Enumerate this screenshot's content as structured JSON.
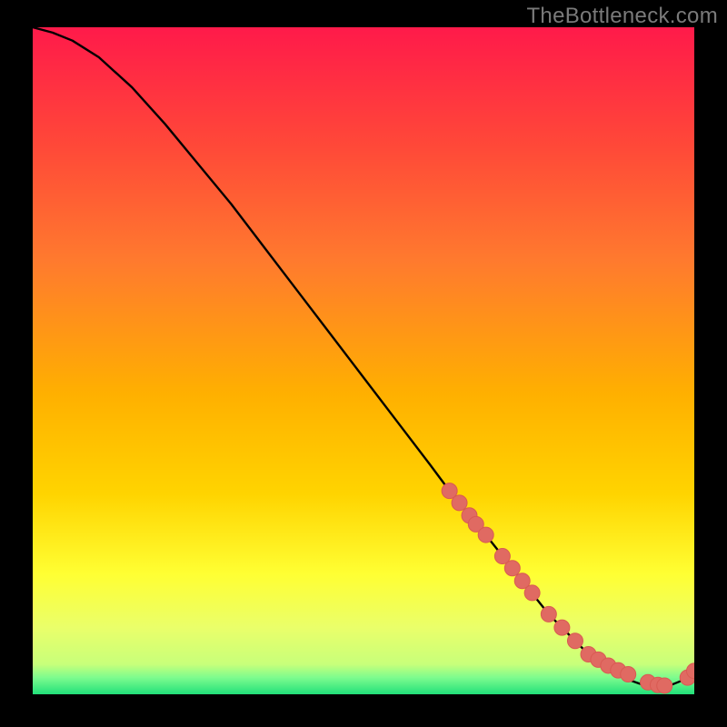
{
  "watermark": "TheBottleneck.com",
  "colors": {
    "bg": "#000000",
    "gradient_top": "#ff1a4a",
    "gradient_mid1": "#ff7a2e",
    "gradient_mid2": "#ffd400",
    "gradient_mid3": "#ffff33",
    "gradient_low": "#eaff6a",
    "gradient_green": "#22e07a",
    "curve": "#000000",
    "marker_fill": "#e06a62",
    "marker_stroke": "#d95a52"
  },
  "chart_data": {
    "type": "line",
    "title": "",
    "xlabel": "",
    "ylabel": "",
    "xlim": [
      0,
      100
    ],
    "ylim": [
      0,
      100
    ],
    "grid": false,
    "series": [
      {
        "name": "bottleneck-curve",
        "x": [
          0,
          3,
          6,
          10,
          15,
          20,
          25,
          30,
          35,
          40,
          45,
          50,
          55,
          60,
          63,
          65,
          68,
          70,
          72,
          74,
          76,
          78,
          80,
          82,
          84,
          86,
          88,
          90,
          92,
          94,
          96,
          98,
          100
        ],
        "y": [
          100,
          99.2,
          98,
          95.5,
          91,
          85.5,
          79.5,
          73.5,
          67,
          60.5,
          54,
          47.5,
          41,
          34.5,
          30.5,
          28,
          24.5,
          22,
          19.5,
          17,
          14.5,
          12,
          10,
          8,
          6,
          4.5,
          3.2,
          2.2,
          1.5,
          1.1,
          1.2,
          2,
          3.5
        ]
      }
    ],
    "markers": {
      "name": "highlighted-points",
      "x": [
        63,
        64.5,
        66,
        67,
        68.5,
        71,
        72.5,
        74,
        75.5,
        78,
        80,
        82,
        84,
        85.5,
        87,
        88.5,
        90,
        93,
        94.5,
        95.5,
        99,
        100
      ],
      "y": [
        30.5,
        28.7,
        26.8,
        25.5,
        23.9,
        20.7,
        18.9,
        17,
        15.2,
        12,
        10,
        8,
        6,
        5.2,
        4.3,
        3.6,
        3,
        1.8,
        1.4,
        1.3,
        2.5,
        3.5
      ]
    }
  }
}
